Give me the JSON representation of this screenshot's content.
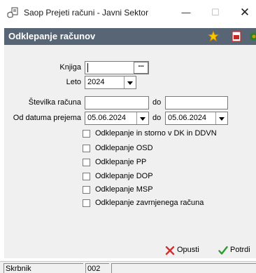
{
  "window": {
    "title": "Saop Prejeti računi - Javni Sektor",
    "minimize": "—",
    "maximize": "☐",
    "close": "✕",
    "app_icon": "hand-document-icon"
  },
  "dialog": {
    "title": "Odklepanje računov",
    "header_icons": [
      "star-icon",
      "pdf-icon",
      "plugin-icon"
    ]
  },
  "form": {
    "knjiga_label": "Knjiga",
    "knjiga_value": "",
    "knjiga_button": "···",
    "leto_label": "Leto",
    "leto_value": "2024",
    "stevilka_label": "Številka računa",
    "stevilka_from": "",
    "stevilka_do_label": "do",
    "stevilka_to": "",
    "datum_label": "Od datuma prejema",
    "datum_from": "05.06.2024",
    "datum_do_label": "do",
    "datum_to": "05.06.2024"
  },
  "checkboxes": [
    {
      "label": "Odklepanje in storno v DK in DDVN",
      "checked": false
    },
    {
      "label": "Odklepanje OSD",
      "checked": false
    },
    {
      "label": "Odklepanje PP",
      "checked": false
    },
    {
      "label": "Odklepanje DOP",
      "checked": false
    },
    {
      "label": "Odklepanje MSP",
      "checked": false
    },
    {
      "label": "Odklepanje zavrnjenega računa",
      "checked": false
    }
  ],
  "buttons": {
    "cancel_label": "Opusti",
    "ok_label": "Potrdi",
    "cancel_icon": "x-icon",
    "ok_icon": "checkmark-icon"
  },
  "statusbar": {
    "user": "Skrbnik",
    "code": "002",
    "extra": ""
  },
  "colors": {
    "header_bg": "#576574",
    "panel_bg": "#f0f0f0",
    "cancel_x": "#d32f2f",
    "ok_check": "#2e9a2e"
  }
}
